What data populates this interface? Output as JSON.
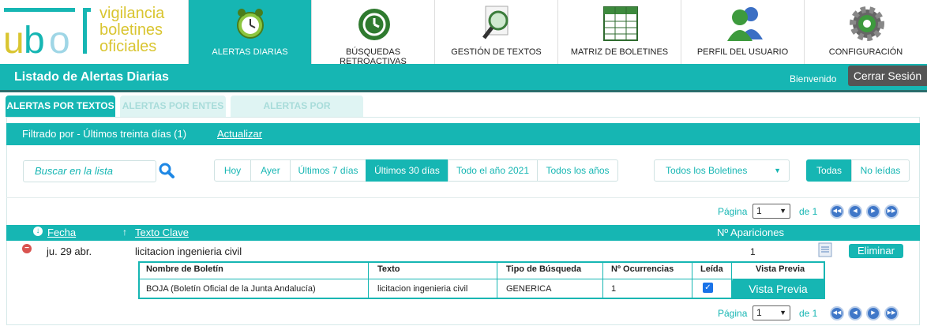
{
  "logo": {
    "letters": "ubo",
    "line1": "vigilancia",
    "line2": "boletines",
    "line3": "oficiales"
  },
  "nav": [
    {
      "label": "ALERTAS DIARIAS",
      "icon": "alarm-clock-icon"
    },
    {
      "label": "BÚSQUEDAS RETROACTIVAS",
      "icon": "history-icon"
    },
    {
      "label": "GESTIÓN DE TEXTOS",
      "icon": "magnifier-document-icon"
    },
    {
      "label": "MATRIZ DE BOLETINES",
      "icon": "spreadsheet-icon"
    },
    {
      "label": "PERFIL DEL USUARIO",
      "icon": "users-icon"
    },
    {
      "label": "CONFIGURACIÓN",
      "icon": "gear-icon"
    }
  ],
  "topbar": {
    "title": "Listado de Alertas Diarias",
    "welcome": "Bienvenido",
    "logout": "Cerrar Sesión"
  },
  "tabs": [
    "ALERTAS POR TEXTOS",
    "ALERTAS POR ENTES",
    "ALERTAS POR EXPEDIENTES"
  ],
  "filter": {
    "text": "Filtrado por - Últimos treinta días (1)",
    "refresh": "Actualizar"
  },
  "search": {
    "placeholder": "Buscar en la lista"
  },
  "periods": [
    "Hoy",
    "Ayer",
    "Últimos 7 días",
    "Últimos 30 días",
    "Todo el año 2021",
    "Todos los años"
  ],
  "boletines": {
    "selected": "Todos los Boletines"
  },
  "read_filter": [
    "Todas",
    "No leídas"
  ],
  "pager": {
    "label": "Página",
    "value": "1",
    "of": "de 1"
  },
  "list_headers": {
    "fecha": "Fecha",
    "texto": "Texto Clave",
    "apariciones": "Nº Apariciones"
  },
  "row": {
    "date": "ju. 29 abr.",
    "text": "licitacion ingenieria civil",
    "count": "1",
    "delete": "Eliminar"
  },
  "detail": {
    "headers": [
      "Nombre de Boletín",
      "Texto",
      "Tipo de Búsqueda",
      "Nº Ocurrencias",
      "Leída",
      "Vista Previa"
    ],
    "cells": [
      "BOJA (Boletín Oficial de la Junta Andalucía)",
      "licitacion ingenieria civil",
      "GENERICA",
      "1"
    ],
    "preview": "Vista Previa"
  },
  "colors": {
    "accent": "#16b6b3",
    "logout": "#555555"
  }
}
